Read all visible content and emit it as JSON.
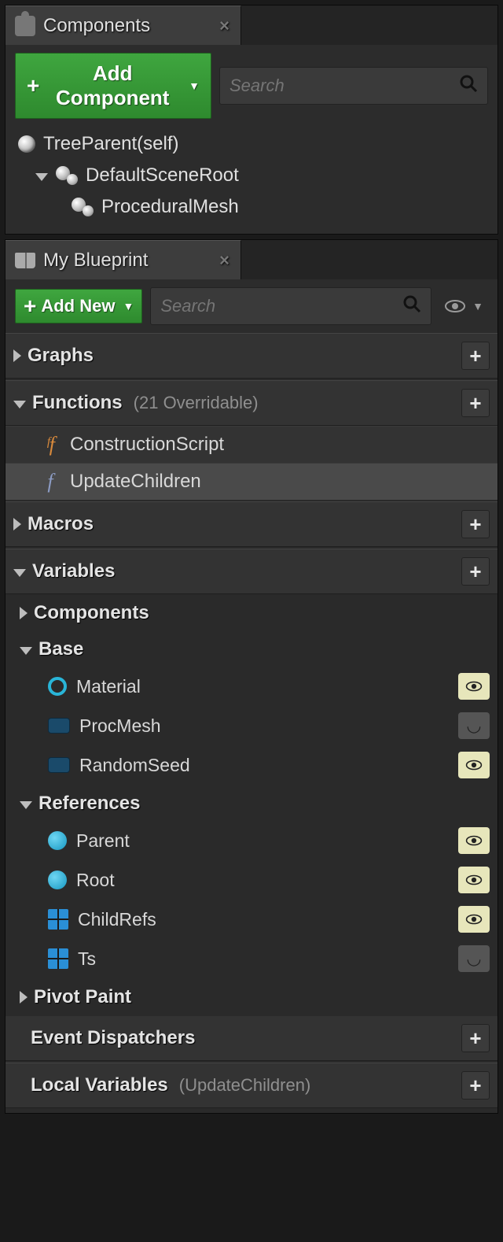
{
  "components_panel": {
    "title": "Components",
    "add_button": "Add Component",
    "search_placeholder": "Search",
    "tree": {
      "root": "TreeParent(self)",
      "scene_root": "DefaultSceneRoot",
      "child1": "ProceduralMesh"
    }
  },
  "blueprint_panel": {
    "title": "My Blueprint",
    "add_button": "Add New",
    "search_placeholder": "Search",
    "categories": {
      "graphs": {
        "label": "Graphs"
      },
      "functions": {
        "label": "Functions",
        "sub": "(21 Overridable)",
        "items": {
          "f1": "ConstructionScript",
          "f2": "UpdateChildren"
        }
      },
      "macros": {
        "label": "Macros"
      },
      "variables": {
        "label": "Variables",
        "groups": {
          "components": {
            "label": "Components"
          },
          "base": {
            "label": "Base",
            "vars": {
              "v1": "Material",
              "v2": "ProcMesh",
              "v3": "RandomSeed"
            }
          },
          "references": {
            "label": "References",
            "vars": {
              "v1": "Parent",
              "v2": "Root",
              "v3": "ChildRefs",
              "v4": "Ts"
            }
          },
          "pivot": {
            "label": "Pivot Paint"
          }
        }
      },
      "dispatchers": {
        "label": "Event Dispatchers"
      },
      "locals": {
        "label": "Local Variables",
        "sub": "(UpdateChildren)"
      }
    }
  }
}
